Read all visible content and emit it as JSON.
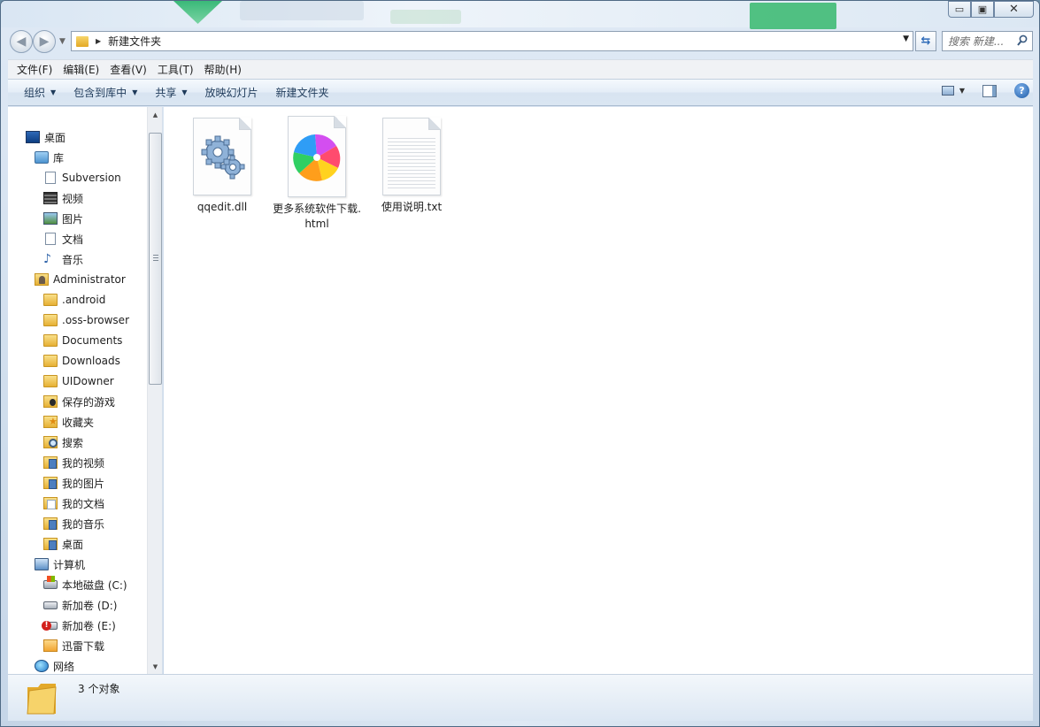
{
  "window": {
    "minimize_label": "▭",
    "maximize_label": "▣",
    "close_label": "✕"
  },
  "address_bar": {
    "path": "新建文件夹",
    "refresh_symbol": "⇆"
  },
  "search": {
    "placeholder": "搜索 新建..."
  },
  "menu": [
    "文件(F)",
    "编辑(E)",
    "查看(V)",
    "工具(T)",
    "帮助(H)"
  ],
  "commands": {
    "organize": "组织",
    "include_in_library": "包含到库中",
    "share": "共享",
    "slideshow": "放映幻灯片",
    "new_folder": "新建文件夹",
    "help": "?"
  },
  "nav_tree": [
    {
      "label": "桌面",
      "icon": "desktop-icon"
    },
    {
      "label": "库",
      "icon": "library-icon"
    },
    {
      "label": "Subversion",
      "icon": "document-icon"
    },
    {
      "label": "视频",
      "icon": "video-icon"
    },
    {
      "label": "图片",
      "icon": "picture-icon"
    },
    {
      "label": "文档",
      "icon": "document-icon"
    },
    {
      "label": "音乐",
      "icon": "music-icon"
    },
    {
      "label": "Administrator",
      "icon": "user-folder-icon"
    },
    {
      "label": ".android",
      "icon": "folder-icon"
    },
    {
      "label": ".oss-browser",
      "icon": "folder-icon"
    },
    {
      "label": "Documents",
      "icon": "folder-icon"
    },
    {
      "label": "Downloads",
      "icon": "folder-icon"
    },
    {
      "label": "UIDowner",
      "icon": "folder-icon"
    },
    {
      "label": "保存的游戏",
      "icon": "saved-games-icon"
    },
    {
      "label": "收藏夹",
      "icon": "favorites-icon"
    },
    {
      "label": "搜索",
      "icon": "searches-icon"
    },
    {
      "label": "我的视频",
      "icon": "my-videos-icon"
    },
    {
      "label": "我的图片",
      "icon": "my-pictures-icon"
    },
    {
      "label": "我的文档",
      "icon": "my-documents-icon"
    },
    {
      "label": "我的音乐",
      "icon": "my-music-icon"
    },
    {
      "label": "桌面",
      "icon": "desktop-folder-icon"
    },
    {
      "label": "计算机",
      "icon": "computer-icon"
    },
    {
      "label": "本地磁盘 (C:)",
      "icon": "drive-c-icon"
    },
    {
      "label": "新加卷 (D:)",
      "icon": "drive-icon"
    },
    {
      "label": "新加卷 (E:)",
      "icon": "drive-error-icon"
    },
    {
      "label": "迅雷下载",
      "icon": "xunlei-folder-icon"
    },
    {
      "label": "网络",
      "icon": "network-icon"
    }
  ],
  "files": [
    {
      "name": "qqedit.dll",
      "icon": "dll-gear-icon"
    },
    {
      "name": "更多系统软件下载.html",
      "icon": "browser-pinwheel-icon"
    },
    {
      "name": "使用说明.txt",
      "icon": "text-file-icon"
    }
  ],
  "details": {
    "count_text": "3 个对象"
  }
}
